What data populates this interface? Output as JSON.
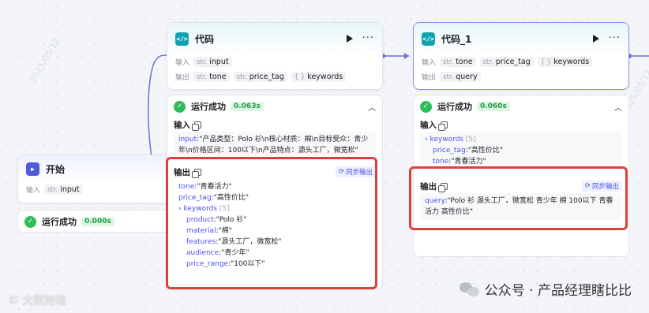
{
  "node_code": {
    "title": "代码",
    "input_label": "输入",
    "output_label": "输出",
    "inputs": [
      {
        "type": "str.",
        "name": "input"
      }
    ],
    "outputs": [
      {
        "type": "str.",
        "name": "tone"
      },
      {
        "type": "str.",
        "name": "price_tag"
      },
      {
        "type": "{ }",
        "name": "keywords"
      }
    ]
  },
  "node_code1": {
    "title": "代码_1",
    "input_label": "输入",
    "output_label": "输出",
    "inputs": [
      {
        "type": "str.",
        "name": "tone"
      },
      {
        "type": "str.",
        "name": "price_tag"
      },
      {
        "type": "{ }",
        "name": "keywords"
      }
    ],
    "outputs": [
      {
        "type": "str.",
        "name": "query"
      }
    ]
  },
  "node_start": {
    "title": "开始",
    "output_label": "输入",
    "outputs": [
      {
        "type": "str.",
        "name": "input"
      }
    ]
  },
  "status_code": {
    "text": "运行成功",
    "time": "0.063s",
    "input_title": "输入",
    "input_key": "input",
    "input_value": ":\"产品类型：Polo 衫\\n核心材质：棉\\n目标受众：青少年\\n价格区间：100以下\\n产品特点：源头工厂，微宽松\"",
    "output_title": "输出",
    "sync_label": "同步输出",
    "outputs": [
      {
        "key": "tone",
        "value": ":\"青春活力\""
      },
      {
        "key": "price_tag",
        "value": ":\"高性价比\""
      }
    ],
    "keywords_key": "keywords",
    "keywords_count": "[5]",
    "keywords": [
      {
        "key": "product",
        "value": ":\"Polo 衫\""
      },
      {
        "key": "material",
        "value": ":\"棉\""
      },
      {
        "key": "features",
        "value": ":\"源头工厂，微宽松\""
      },
      {
        "key": "audience",
        "value": ":\"青少年\""
      },
      {
        "key": "price_range",
        "value": ":\"100以下\""
      }
    ]
  },
  "status_code1": {
    "text": "运行成功",
    "time": "0.060s",
    "input_title": "输入",
    "keywords_key": "keywords",
    "keywords_count": "[5]",
    "inputs": [
      {
        "key": "price_tag",
        "value": ":\"高性价比\""
      },
      {
        "key": "tone",
        "value": ":\"青春活力\""
      }
    ],
    "output_title": "输出",
    "sync_label": "同步输出",
    "query_key": "query",
    "query_value": ":\"Polo 衫 源头工厂，微宽松 青少年 棉 100以下 青春活力 高性价比\""
  },
  "status_start": {
    "text": "运行成功",
    "time": "0.000s"
  },
  "watermark": {
    "brand": "大数跨境",
    "wechat": "公众号 · 产品经理瞎比比"
  },
  "colors": {
    "accent": "#4d53e8",
    "success": "#2fbc5a",
    "highlight_box": "#d9413a",
    "code_icon": "#11a2b0"
  }
}
